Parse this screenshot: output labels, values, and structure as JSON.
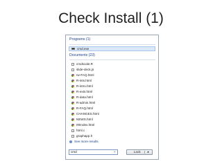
{
  "slide": {
    "title": "Check Install (1)"
  },
  "start_menu": {
    "programs_header": "Programs (1)",
    "programs": [
      {
        "label": "cmd.exe",
        "icon": "console-icon"
      }
    ],
    "documents_header": "Documents (23)",
    "documents": [
      {
        "label": "cmdscale.R",
        "icon": "file-icon"
      },
      {
        "label": "slide-deck.js",
        "icon": "file-icon"
      },
      {
        "label": "rw-FAQ.html",
        "icon": "html-icon"
      },
      {
        "label": "R-ints.html",
        "icon": "html-icon"
      },
      {
        "label": "R-intro.html",
        "icon": "html-icon"
      },
      {
        "label": "R-exts.html",
        "icon": "html-icon"
      },
      {
        "label": "R-data.html",
        "icon": "html-icon"
      },
      {
        "label": "R-admin.html",
        "icon": "html-icon"
      },
      {
        "label": "R-FAQ.html",
        "icon": "html-icon"
      },
      {
        "label": "CHANGES.html",
        "icon": "html-icon"
      },
      {
        "label": "NEWS.html",
        "icon": "html-icon"
      },
      {
        "label": "00Index.html",
        "icon": "html-icon"
      },
      {
        "label": "html.c",
        "icon": "file-icon"
      },
      {
        "label": "graphapp.h",
        "icon": "file-icon"
      }
    ],
    "see_more": "See more results",
    "search": {
      "value": "cmd",
      "clear": "×"
    },
    "lock_button": {
      "label": "Lock",
      "arrow": "▸"
    }
  }
}
